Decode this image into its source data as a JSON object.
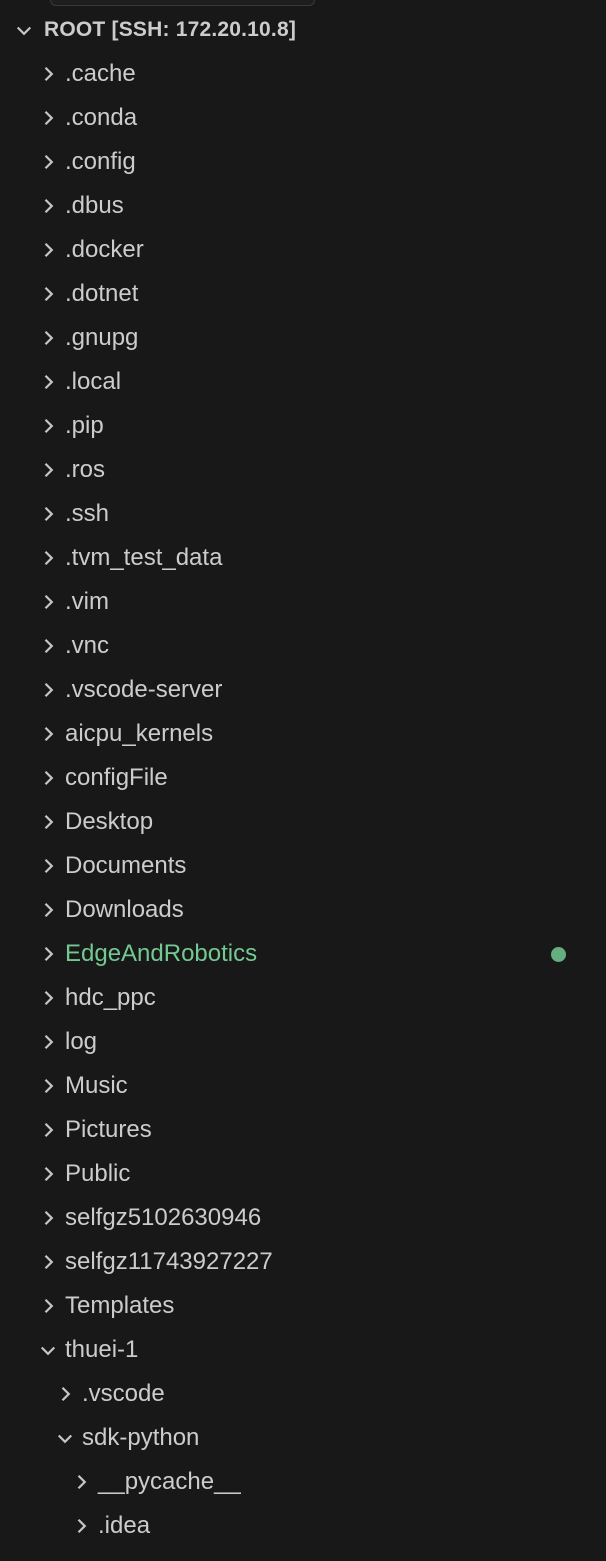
{
  "explorer": {
    "root_label": "ROOT [SSH: 172.20.10.8]",
    "status_color": "#73c991",
    "items": [
      {
        "label": ".cache",
        "level": 1,
        "expanded": false
      },
      {
        "label": ".conda",
        "level": 1,
        "expanded": false
      },
      {
        "label": ".config",
        "level": 1,
        "expanded": false
      },
      {
        "label": ".dbus",
        "level": 1,
        "expanded": false
      },
      {
        "label": ".docker",
        "level": 1,
        "expanded": false
      },
      {
        "label": ".dotnet",
        "level": 1,
        "expanded": false
      },
      {
        "label": ".gnupg",
        "level": 1,
        "expanded": false
      },
      {
        "label": ".local",
        "level": 1,
        "expanded": false
      },
      {
        "label": ".pip",
        "level": 1,
        "expanded": false
      },
      {
        "label": ".ros",
        "level": 1,
        "expanded": false
      },
      {
        "label": ".ssh",
        "level": 1,
        "expanded": false
      },
      {
        "label": ".tvm_test_data",
        "level": 1,
        "expanded": false
      },
      {
        "label": ".vim",
        "level": 1,
        "expanded": false
      },
      {
        "label": ".vnc",
        "level": 1,
        "expanded": false
      },
      {
        "label": ".vscode-server",
        "level": 1,
        "expanded": false
      },
      {
        "label": "aicpu_kernels",
        "level": 1,
        "expanded": false
      },
      {
        "label": "configFile",
        "level": 1,
        "expanded": false
      },
      {
        "label": "Desktop",
        "level": 1,
        "expanded": false
      },
      {
        "label": "Documents",
        "level": 1,
        "expanded": false
      },
      {
        "label": "Downloads",
        "level": 1,
        "expanded": false
      },
      {
        "label": "EdgeAndRobotics",
        "level": 1,
        "expanded": false,
        "modified": true
      },
      {
        "label": "hdc_ppc",
        "level": 1,
        "expanded": false
      },
      {
        "label": "log",
        "level": 1,
        "expanded": false
      },
      {
        "label": "Music",
        "level": 1,
        "expanded": false
      },
      {
        "label": "Pictures",
        "level": 1,
        "expanded": false
      },
      {
        "label": "Public",
        "level": 1,
        "expanded": false
      },
      {
        "label": "selfgz5102630946",
        "level": 1,
        "expanded": false
      },
      {
        "label": "selfgz11743927227",
        "level": 1,
        "expanded": false
      },
      {
        "label": "Templates",
        "level": 1,
        "expanded": false
      },
      {
        "label": "thuei-1",
        "level": 1,
        "expanded": true
      },
      {
        "label": ".vscode",
        "level": 2,
        "expanded": false
      },
      {
        "label": "sdk-python",
        "level": 2,
        "expanded": true
      },
      {
        "label": "__pycache__",
        "level": 3,
        "expanded": false
      },
      {
        "label": ".idea",
        "level": 3,
        "expanded": false
      }
    ]
  }
}
